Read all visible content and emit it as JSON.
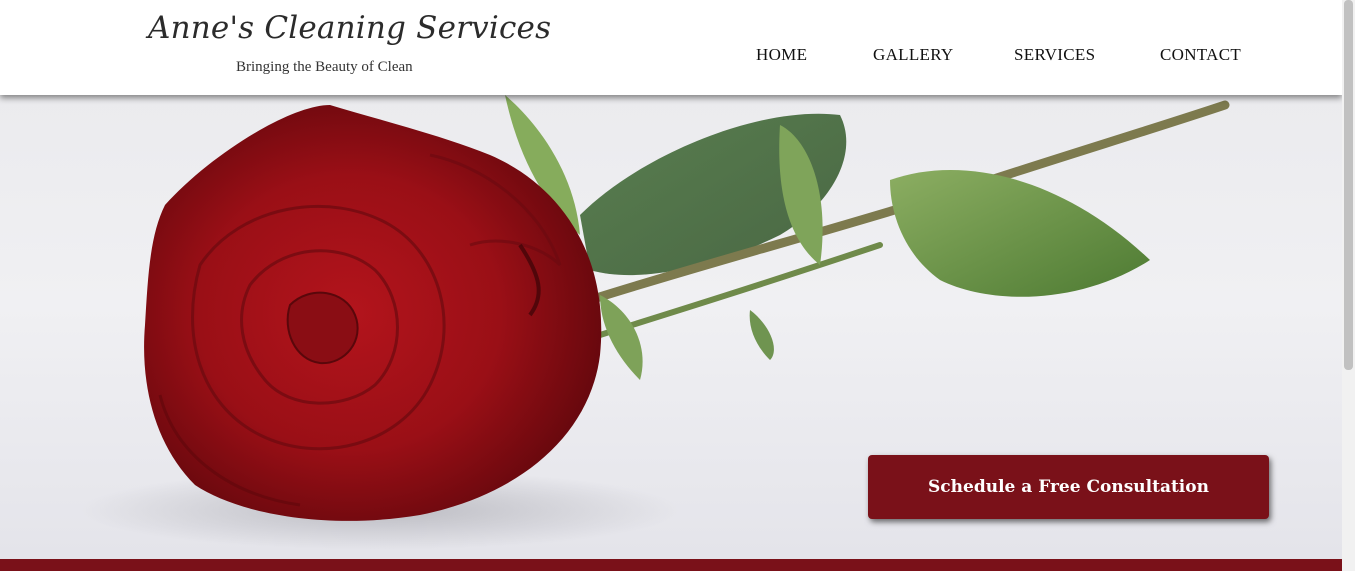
{
  "brand": {
    "title": "Anne's Cleaning Services",
    "tagline": "Bringing the Beauty of Clean"
  },
  "nav": {
    "items": [
      {
        "label": "HOME"
      },
      {
        "label": "GALLERY"
      },
      {
        "label": "SERVICES"
      },
      {
        "label": "CONTACT"
      }
    ]
  },
  "hero": {
    "image": "red-rose-photo",
    "cta_label": "Schedule a Free Consultation"
  },
  "colors": {
    "accent": "#7a1119",
    "header_bg": "#ffffff",
    "nav_text": "#111111"
  }
}
